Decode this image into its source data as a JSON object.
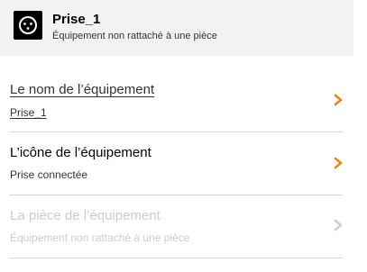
{
  "header": {
    "device_name": "Prise_1",
    "room_status": "Équipement non rattaché à une pièce",
    "icon": "smart-plug-icon"
  },
  "settings": [
    {
      "label": "Le nom de l’équipement",
      "value": "Prise_1",
      "enabled": true,
      "chevron_color": "#ff7900"
    },
    {
      "label": "L’icône de l’équipement",
      "value": "Prise connectée",
      "enabled": true,
      "chevron_color": "#ff7900"
    },
    {
      "label": "La pièce de l’équipement",
      "value": "Équipement non rattaché à une pièce",
      "enabled": false,
      "chevron_color": "#cccccc"
    }
  ],
  "colors": {
    "accent": "#ff7900",
    "header_background": "#f2f2f2",
    "disabled_text": "#cccccc"
  }
}
